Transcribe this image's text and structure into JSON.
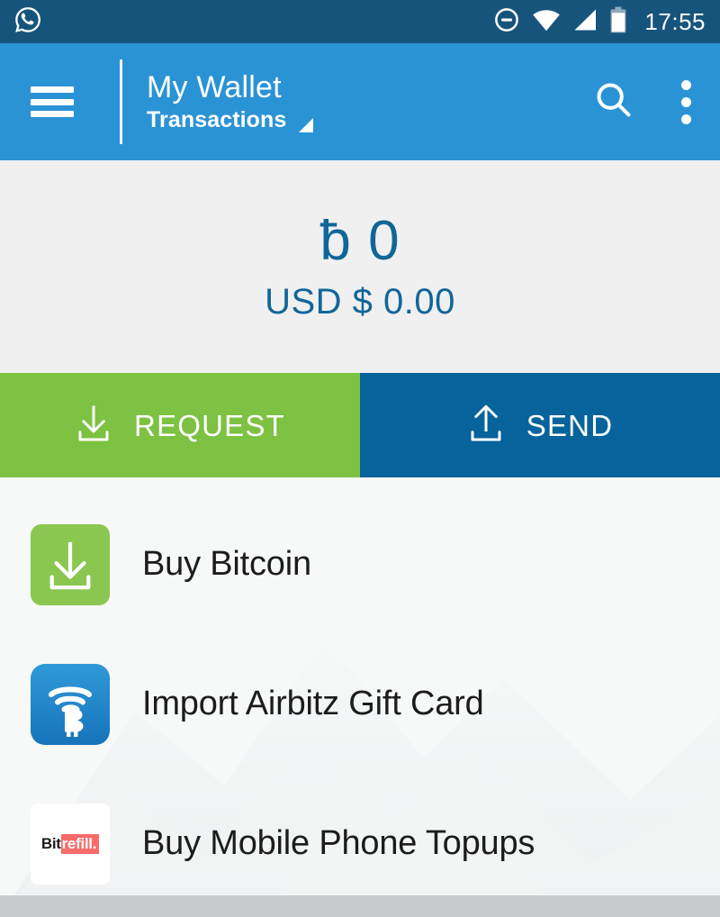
{
  "statusbar": {
    "time": "17:55",
    "icons": [
      {
        "name": "whatsapp-icon",
        "label": "WhatsApp notification"
      },
      {
        "name": "do-not-disturb-icon",
        "label": "Do not disturb"
      },
      {
        "name": "wifi-icon",
        "label": "Wi-Fi"
      },
      {
        "name": "cell-signal-icon",
        "label": "Cellular signal"
      },
      {
        "name": "battery-icon",
        "label": "Battery"
      }
    ],
    "background": "#17547c"
  },
  "appbar": {
    "menu_label": "Menu",
    "title": "My Wallet",
    "subtitle": "Transactions",
    "dropdown_hint": "Open wallet list",
    "search_label": "Search",
    "overflow_label": "More options",
    "background": "#2a93d5"
  },
  "balance": {
    "btc_amount": "ƀ 0",
    "fiat_amount": "USD $ 0.00",
    "text_color": "#116699",
    "background": "#f0f0f0"
  },
  "actions": {
    "request": {
      "label": "REQUEST",
      "icon": "download-arrow-icon",
      "color": "#7dc242"
    },
    "send": {
      "label": "SEND",
      "icon": "upload-arrow-icon",
      "color": "#06639c"
    }
  },
  "list": {
    "items": [
      {
        "label": "Buy Bitcoin",
        "icon": "download-arrow-icon",
        "icon_color": "#8bc750"
      },
      {
        "label": "Import Airbitz Gift Card",
        "icon": "airbitz-logo-icon",
        "icon_color": "#1f86cc"
      },
      {
        "label": "Buy Mobile Phone Topups",
        "icon": "bitrefill-logo-icon",
        "icon_color": "#f76b6b"
      }
    ]
  },
  "bitrefill_logo": {
    "part1": "Bit",
    "part2": "refill.",
    "highlight_color": "#f76b6b"
  }
}
